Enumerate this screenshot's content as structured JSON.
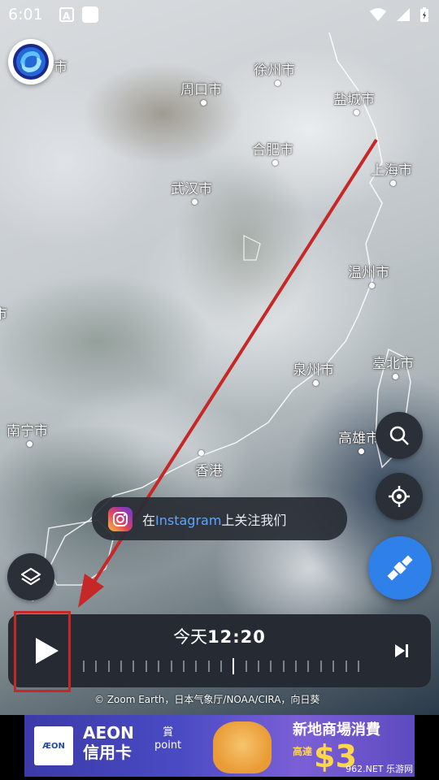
{
  "status_bar": {
    "time": "6:01",
    "notif_a": "A"
  },
  "map": {
    "cities": [
      {
        "key": "sz_tail",
        "name": "市"
      },
      {
        "key": "xuzhou",
        "name": "徐州市"
      },
      {
        "key": "zhoukou",
        "name": "周口市"
      },
      {
        "key": "yancheng",
        "name": "盐城市"
      },
      {
        "key": "hefei",
        "name": "合肥市"
      },
      {
        "key": "shanghai",
        "name": "上海市"
      },
      {
        "key": "wuhan",
        "name": "武汉市"
      },
      {
        "key": "wenzhou",
        "name": "温州市"
      },
      {
        "key": "left_edge",
        "name": "市"
      },
      {
        "key": "quanzhou",
        "name": "泉州市"
      },
      {
        "key": "taibei",
        "name": "臺北市"
      },
      {
        "key": "nanning",
        "name": "南宁市"
      },
      {
        "key": "gaoxiong",
        "name": "高雄市"
      },
      {
        "key": "hongkong",
        "name": "香港"
      }
    ]
  },
  "toast": {
    "prefix": "在",
    "brand": "Instagram",
    "suffix": "上关注我们",
    "icon": "instagram-icon"
  },
  "player": {
    "day_label": "今天",
    "time_value": "12:20",
    "credit": "© Zoom Earth，日本气象厅/NOAA/CIRA，向日葵"
  },
  "controls": {
    "search_icon": "search-icon",
    "locate_icon": "crosshair-icon",
    "satellite_icon": "satellite-icon",
    "layers_icon": "layers-icon",
    "play_icon": "play-icon",
    "next_icon": "skip-next-icon"
  },
  "ad": {
    "brand_line1": "AEON",
    "brand_line2": "信用卡",
    "logo_text": "ÆON",
    "point_line1": "賞",
    "point_line2": "point",
    "title": "新地商場消費",
    "sub": "高達",
    "big": "$3",
    "watermark": "962.NET 乐游网"
  },
  "colors": {
    "accent_blue": "#2f80e8",
    "annotation_red": "#c62828",
    "panel_bg": "#262b33"
  }
}
